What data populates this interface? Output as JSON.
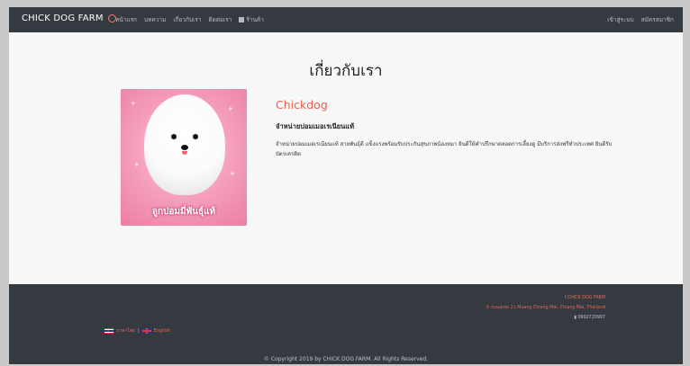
{
  "navbar": {
    "brand": "CHICK DOG FARM",
    "links": [
      "หน้าแรก",
      "บทความ",
      "เกี่ยวกับเรา",
      "ติดต่อเรา",
      "ร้านค้า"
    ],
    "right_links": [
      "เข้าสู่ระบบ",
      "สมัครสมาชิก"
    ]
  },
  "page": {
    "title": "เกี่ยวกับเรา"
  },
  "about": {
    "photo_caption": "ลูกปอมมี่พันธุ์แท้",
    "heading": "Chickdog",
    "subheading": "จำหน่ายปอมเมอเรเนียนแท้",
    "description": "จำหน่ายปอมเมอเรเนียนแท้ สายพันธุ์ดี แข็งแรงพร้อมรับประกันสุขภาพน้องหมา ยินดีให้คำปรึกษาตลอดการเลี้ยงดู มีบริการส่งฟรีทั่วประเทศ ยินดีรับบัตรเครดิต"
  },
  "footer": {
    "facebook": "CHICK DOG FARM",
    "address": "ถนนสุเทพ 21 Muang Chiang Mai, Chiang Mai, Thailand",
    "phone": "0992720997",
    "lang_thai": "ภาษาไทย",
    "lang_sep": "|",
    "lang_english": "English",
    "copyright": "© Copyright 2019 by CHICK DOG FARM. All Rights Reserved."
  },
  "colors": {
    "navbar": "#343a40",
    "accent": "#e8624f",
    "background": "#f7f7f7"
  }
}
